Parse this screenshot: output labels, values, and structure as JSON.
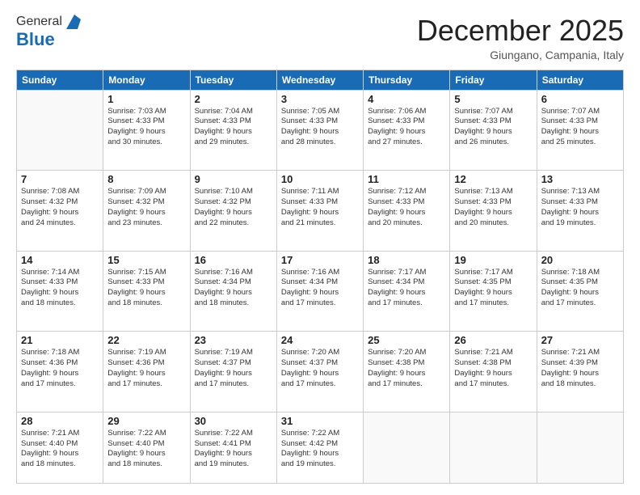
{
  "header": {
    "logo_general": "General",
    "logo_blue": "Blue",
    "month_title": "December 2025",
    "location": "Giungano, Campania, Italy"
  },
  "days_of_week": [
    "Sunday",
    "Monday",
    "Tuesday",
    "Wednesday",
    "Thursday",
    "Friday",
    "Saturday"
  ],
  "weeks": [
    [
      {
        "day": "",
        "info": ""
      },
      {
        "day": "1",
        "info": "Sunrise: 7:03 AM\nSunset: 4:33 PM\nDaylight: 9 hours\nand 30 minutes."
      },
      {
        "day": "2",
        "info": "Sunrise: 7:04 AM\nSunset: 4:33 PM\nDaylight: 9 hours\nand 29 minutes."
      },
      {
        "day": "3",
        "info": "Sunrise: 7:05 AM\nSunset: 4:33 PM\nDaylight: 9 hours\nand 28 minutes."
      },
      {
        "day": "4",
        "info": "Sunrise: 7:06 AM\nSunset: 4:33 PM\nDaylight: 9 hours\nand 27 minutes."
      },
      {
        "day": "5",
        "info": "Sunrise: 7:07 AM\nSunset: 4:33 PM\nDaylight: 9 hours\nand 26 minutes."
      },
      {
        "day": "6",
        "info": "Sunrise: 7:07 AM\nSunset: 4:33 PM\nDaylight: 9 hours\nand 25 minutes."
      }
    ],
    [
      {
        "day": "7",
        "info": "Sunrise: 7:08 AM\nSunset: 4:32 PM\nDaylight: 9 hours\nand 24 minutes."
      },
      {
        "day": "8",
        "info": "Sunrise: 7:09 AM\nSunset: 4:32 PM\nDaylight: 9 hours\nand 23 minutes."
      },
      {
        "day": "9",
        "info": "Sunrise: 7:10 AM\nSunset: 4:32 PM\nDaylight: 9 hours\nand 22 minutes."
      },
      {
        "day": "10",
        "info": "Sunrise: 7:11 AM\nSunset: 4:33 PM\nDaylight: 9 hours\nand 21 minutes."
      },
      {
        "day": "11",
        "info": "Sunrise: 7:12 AM\nSunset: 4:33 PM\nDaylight: 9 hours\nand 20 minutes."
      },
      {
        "day": "12",
        "info": "Sunrise: 7:13 AM\nSunset: 4:33 PM\nDaylight: 9 hours\nand 20 minutes."
      },
      {
        "day": "13",
        "info": "Sunrise: 7:13 AM\nSunset: 4:33 PM\nDaylight: 9 hours\nand 19 minutes."
      }
    ],
    [
      {
        "day": "14",
        "info": "Sunrise: 7:14 AM\nSunset: 4:33 PM\nDaylight: 9 hours\nand 18 minutes."
      },
      {
        "day": "15",
        "info": "Sunrise: 7:15 AM\nSunset: 4:33 PM\nDaylight: 9 hours\nand 18 minutes."
      },
      {
        "day": "16",
        "info": "Sunrise: 7:16 AM\nSunset: 4:34 PM\nDaylight: 9 hours\nand 18 minutes."
      },
      {
        "day": "17",
        "info": "Sunrise: 7:16 AM\nSunset: 4:34 PM\nDaylight: 9 hours\nand 17 minutes."
      },
      {
        "day": "18",
        "info": "Sunrise: 7:17 AM\nSunset: 4:34 PM\nDaylight: 9 hours\nand 17 minutes."
      },
      {
        "day": "19",
        "info": "Sunrise: 7:17 AM\nSunset: 4:35 PM\nDaylight: 9 hours\nand 17 minutes."
      },
      {
        "day": "20",
        "info": "Sunrise: 7:18 AM\nSunset: 4:35 PM\nDaylight: 9 hours\nand 17 minutes."
      }
    ],
    [
      {
        "day": "21",
        "info": "Sunrise: 7:18 AM\nSunset: 4:36 PM\nDaylight: 9 hours\nand 17 minutes."
      },
      {
        "day": "22",
        "info": "Sunrise: 7:19 AM\nSunset: 4:36 PM\nDaylight: 9 hours\nand 17 minutes."
      },
      {
        "day": "23",
        "info": "Sunrise: 7:19 AM\nSunset: 4:37 PM\nDaylight: 9 hours\nand 17 minutes."
      },
      {
        "day": "24",
        "info": "Sunrise: 7:20 AM\nSunset: 4:37 PM\nDaylight: 9 hours\nand 17 minutes."
      },
      {
        "day": "25",
        "info": "Sunrise: 7:20 AM\nSunset: 4:38 PM\nDaylight: 9 hours\nand 17 minutes."
      },
      {
        "day": "26",
        "info": "Sunrise: 7:21 AM\nSunset: 4:38 PM\nDaylight: 9 hours\nand 17 minutes."
      },
      {
        "day": "27",
        "info": "Sunrise: 7:21 AM\nSunset: 4:39 PM\nDaylight: 9 hours\nand 18 minutes."
      }
    ],
    [
      {
        "day": "28",
        "info": "Sunrise: 7:21 AM\nSunset: 4:40 PM\nDaylight: 9 hours\nand 18 minutes."
      },
      {
        "day": "29",
        "info": "Sunrise: 7:22 AM\nSunset: 4:40 PM\nDaylight: 9 hours\nand 18 minutes."
      },
      {
        "day": "30",
        "info": "Sunrise: 7:22 AM\nSunset: 4:41 PM\nDaylight: 9 hours\nand 19 minutes."
      },
      {
        "day": "31",
        "info": "Sunrise: 7:22 AM\nSunset: 4:42 PM\nDaylight: 9 hours\nand 19 minutes."
      },
      {
        "day": "",
        "info": ""
      },
      {
        "day": "",
        "info": ""
      },
      {
        "day": "",
        "info": ""
      }
    ]
  ]
}
